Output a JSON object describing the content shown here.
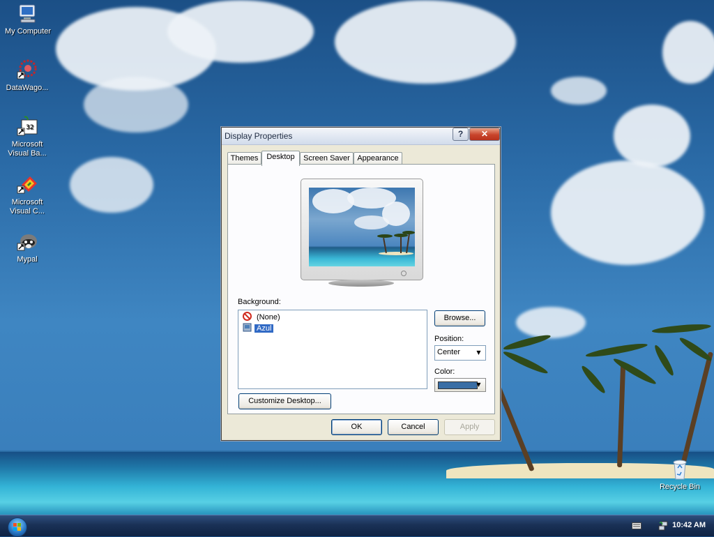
{
  "desktop": {
    "icons": [
      {
        "label": "My Computer"
      },
      {
        "label": "DataWago..."
      },
      {
        "label": "Microsoft Visual Ba..."
      },
      {
        "label": "Microsoft Visual C..."
      },
      {
        "label": "Mypal"
      },
      {
        "label": "Recycle Bin"
      }
    ]
  },
  "dialog": {
    "title": "Display Properties",
    "help_label": "?",
    "close_label": "✕",
    "tabs": [
      "Themes",
      "Desktop",
      "Screen Saver",
      "Appearance"
    ],
    "active_tab": "Desktop",
    "background_label": "Background:",
    "background_items": [
      "(None)",
      "Azul"
    ],
    "selected_background": "Azul",
    "browse_label": "Browse...",
    "position_label": "Position:",
    "position_value": "Center",
    "color_label": "Color:",
    "color_value": "#3a6ea5",
    "customize_label": "Customize Desktop...",
    "ok_label": "OK",
    "cancel_label": "Cancel",
    "apply_label": "Apply"
  },
  "taskbar": {
    "clock": "10:42 AM"
  },
  "colors": {
    "selection": "#316ac5",
    "dialog_face": "#ece9d8",
    "taskbar": "#1a3156"
  }
}
